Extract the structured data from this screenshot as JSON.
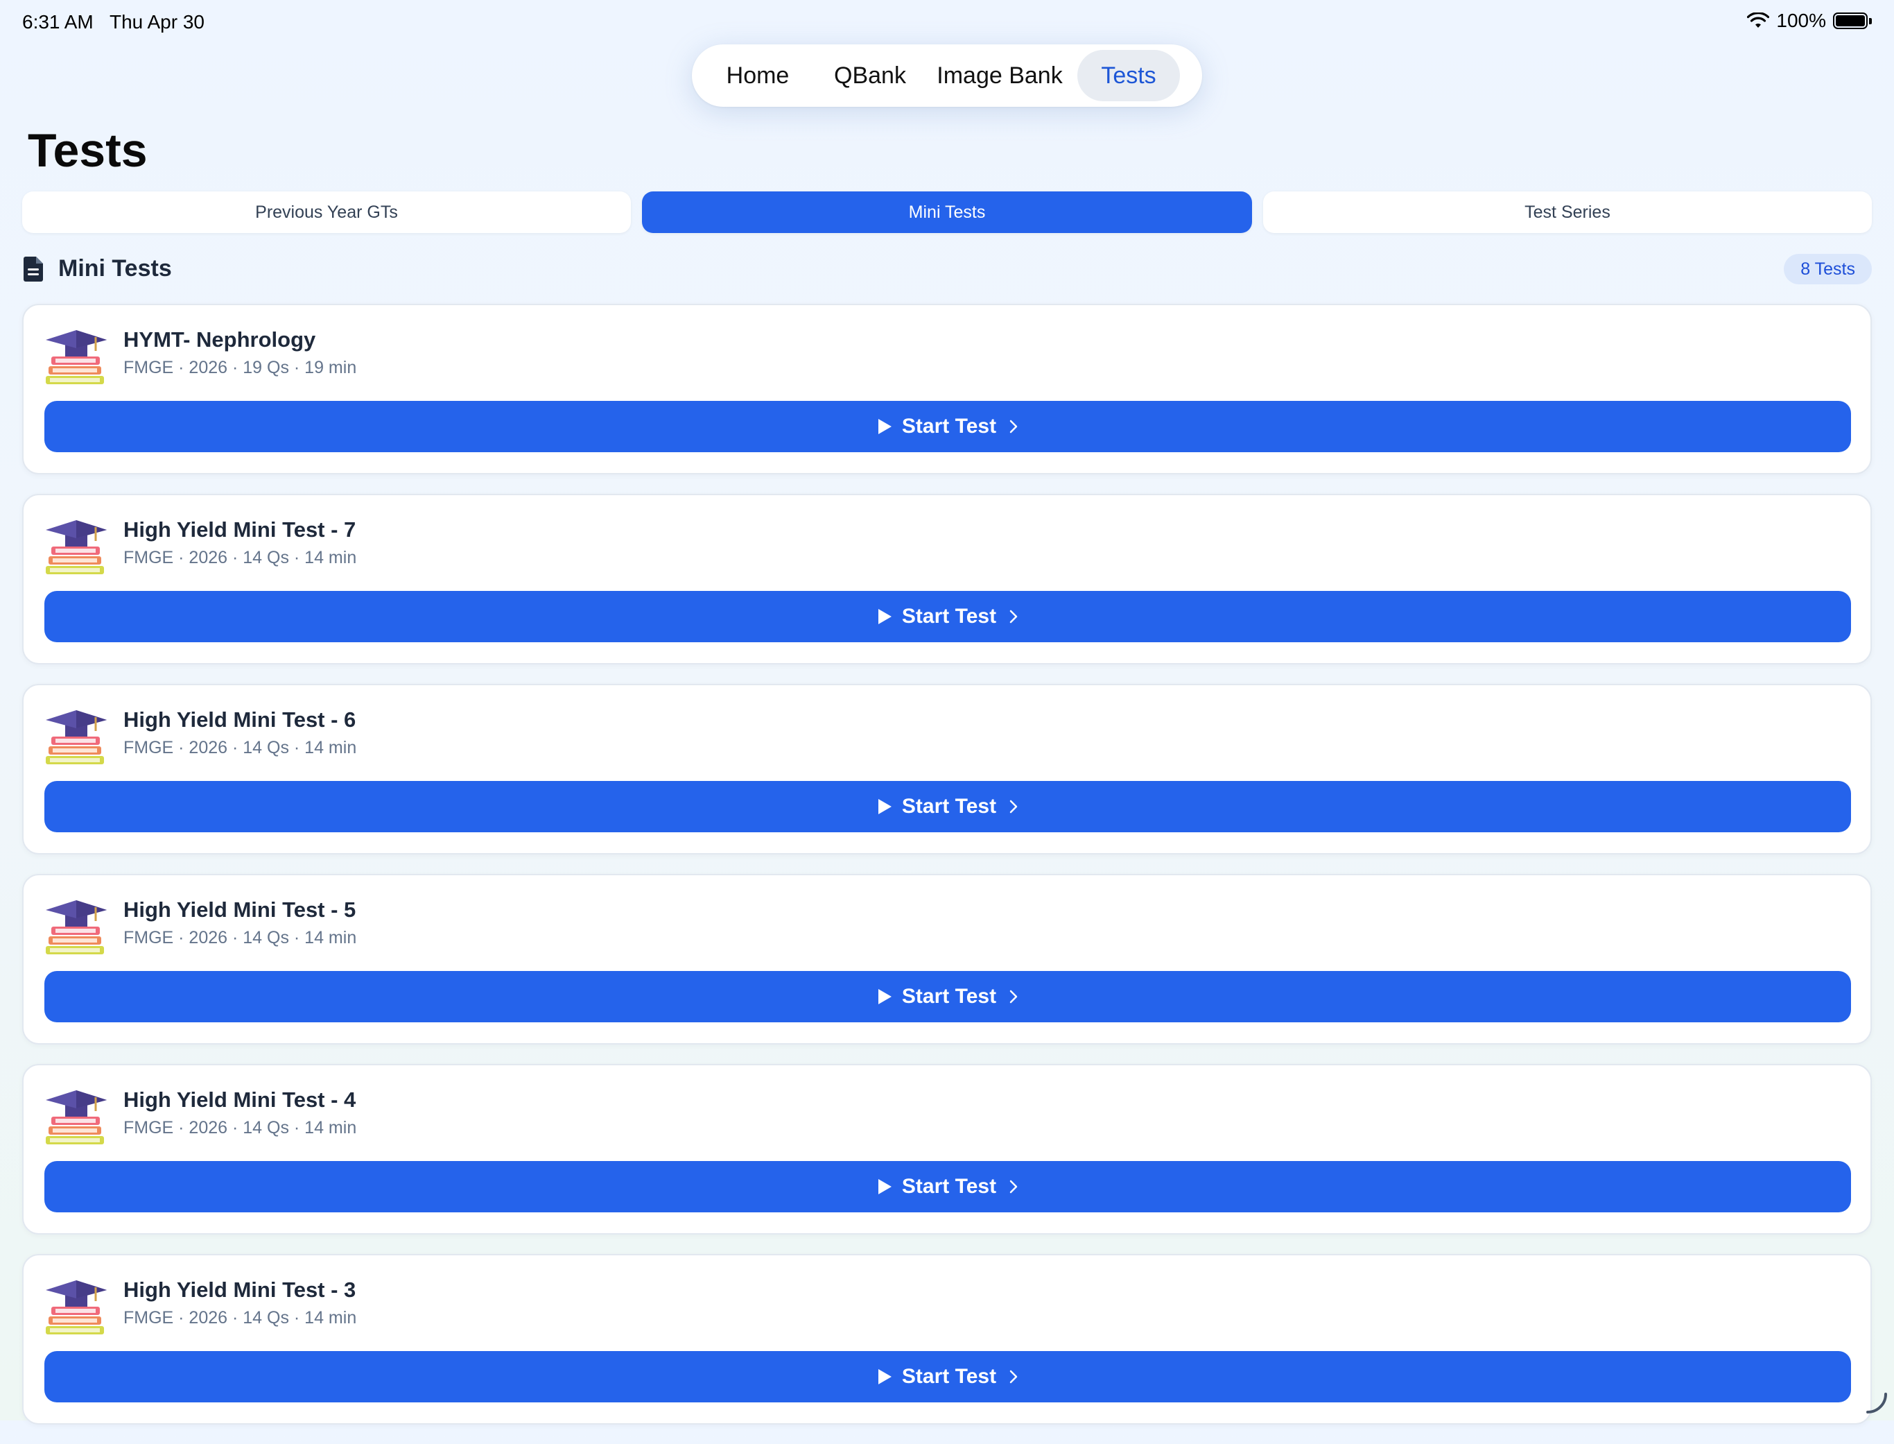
{
  "status_bar": {
    "time": "6:31 AM",
    "date": "Thu Apr 30",
    "battery": "100%"
  },
  "nav": {
    "items": [
      {
        "label": "Home"
      },
      {
        "label": "QBank"
      },
      {
        "label": "Image Bank"
      },
      {
        "label": "Tests",
        "active": true
      }
    ]
  },
  "page": {
    "title": "Tests"
  },
  "segments": [
    {
      "label": "Previous Year GTs"
    },
    {
      "label": "Mini Tests",
      "active": true
    },
    {
      "label": "Test Series"
    }
  ],
  "section": {
    "title": "Mini Tests",
    "count": "8 Tests"
  },
  "tests": [
    {
      "title": "HYMT- Nephrology",
      "meta": "FMGE · 2026 · 19 Qs · 19 min",
      "action": "Start Test"
    },
    {
      "title": "High Yield Mini Test - 7",
      "meta": "FMGE · 2026 · 14 Qs · 14 min",
      "action": "Start Test"
    },
    {
      "title": "High Yield Mini Test - 6",
      "meta": "FMGE · 2026 · 14 Qs · 14 min",
      "action": "Start Test"
    },
    {
      "title": "High Yield Mini Test - 5",
      "meta": "FMGE · 2026 · 14 Qs · 14 min",
      "action": "Start Test"
    },
    {
      "title": "High Yield Mini Test - 4",
      "meta": "FMGE · 2026 · 14 Qs · 14 min",
      "action": "Start Test"
    },
    {
      "title": "High Yield Mini Test - 3",
      "meta": "FMGE · 2026 · 14 Qs · 14 min",
      "action": "Start Test"
    }
  ],
  "colors": {
    "accent": "#2563eb",
    "active_nav_text": "#1d56d6",
    "badge_bg": "#dbe7fb"
  }
}
